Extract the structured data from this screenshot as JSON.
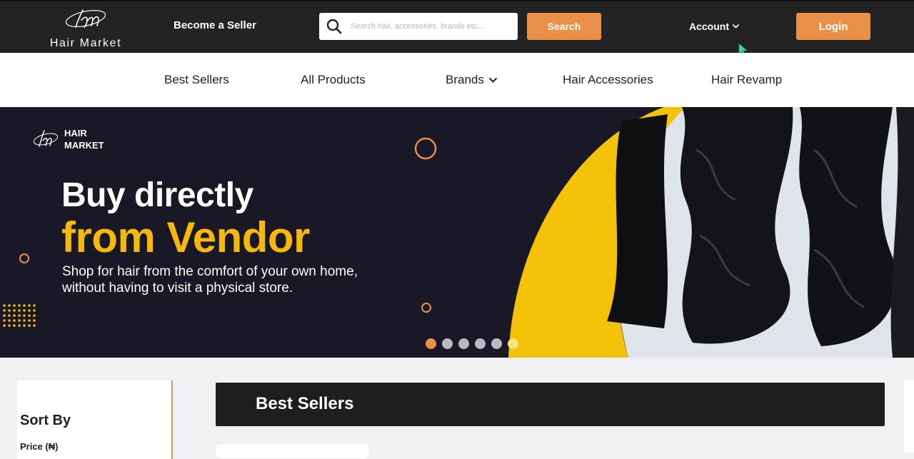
{
  "header": {
    "logo_text": "Hair Market",
    "become_seller": "Become a Seller",
    "search_placeholder": "Search hair, accessories, brands etc...",
    "search_button": "Search",
    "account_label": "Account",
    "login_button": "Login"
  },
  "nav": {
    "items": [
      {
        "label": "Best Sellers"
      },
      {
        "label": "All Products"
      },
      {
        "label": "Brands"
      },
      {
        "label": "Hair Accessories"
      },
      {
        "label": "Hair Revamp"
      }
    ]
  },
  "hero": {
    "logo_line1": "HAIR",
    "logo_line2": "MARKET",
    "title_line1": "Buy directly",
    "title_line2": "from Vendor",
    "subtitle_line1": "Shop for hair from the comfort of your own home,",
    "subtitle_line2": "without having to visit a physical store.",
    "slide_count": 6,
    "active_slide": 1
  },
  "sidebar": {
    "sort_by": "Sort By",
    "price_label": "Price (₦)"
  },
  "main": {
    "section_title": "Best Sellers"
  },
  "colors": {
    "accent": "#e8904a",
    "header_bg": "#232323",
    "hero_bg": "#181826",
    "hero_yellow": "#f5b80b"
  },
  "icons": [
    "search-icon",
    "chevron-down-icon",
    "cursor-icon"
  ]
}
